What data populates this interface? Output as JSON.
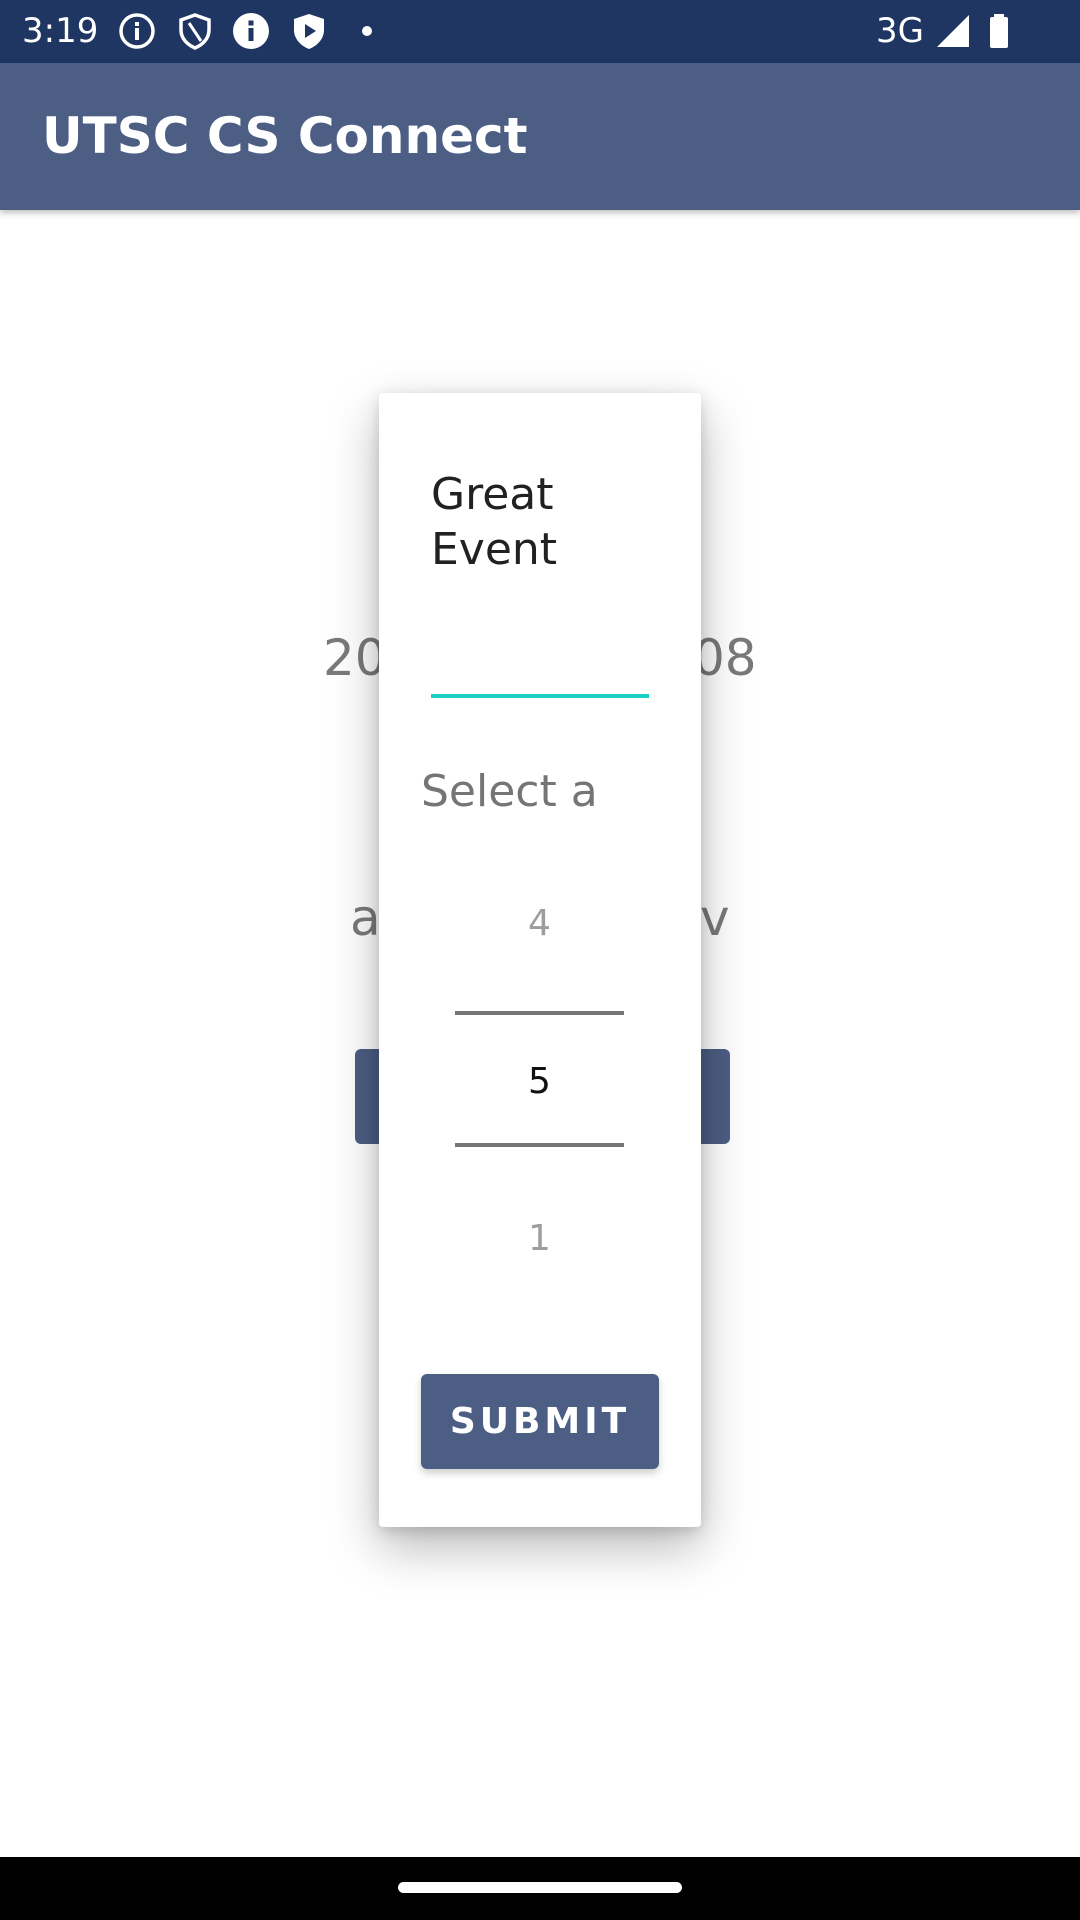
{
  "status_bar": {
    "time": "3:19",
    "network": "3G",
    "icons": [
      "info-icon",
      "shield-icon",
      "info-filled-icon",
      "play-shield-icon",
      "dot-icon",
      "signal-icon",
      "battery-icon"
    ]
  },
  "app_bar": {
    "title": "UTSC CS Connect",
    "color": "#4d5e84"
  },
  "background": {
    "date_left": "20",
    "date_right": "08",
    "text_left": "a",
    "text_right": "v"
  },
  "dialog": {
    "title": "Great Event",
    "input_value": "",
    "select_label": "Select a",
    "picker": {
      "above": "4",
      "selected": "5",
      "below": "1"
    },
    "submit_label": "SUBMIT"
  },
  "colors": {
    "status_bar": "#1f3663",
    "accent": "#1bcfc2",
    "button": "#4d5e84"
  }
}
